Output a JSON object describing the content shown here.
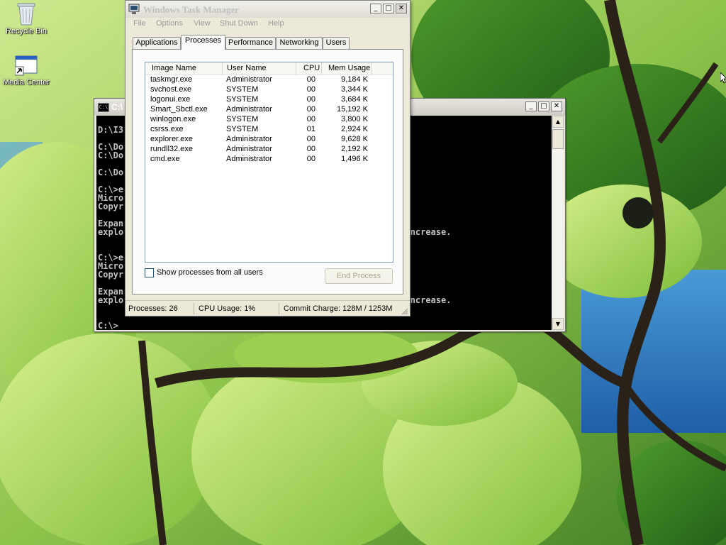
{
  "desktop": {
    "icons": [
      {
        "label": "Recycle Bin",
        "icon": "recycle-bin-icon"
      },
      {
        "label": "Media Center",
        "icon": "media-center-icon"
      }
    ]
  },
  "cmd_window": {
    "title": "C:\\",
    "lines": [
      "D:\\I3",
      "",
      "C:\\Do",
      "C:\\Do",
      "",
      "C:\\Do",
      "",
      "C:\\>e",
      "Micro                                                    @",
      "Copyr                                                    d.",
      "",
      "Expan",
      "explo                                                   89% increase.",
      "",
      "",
      "C:\\>e",
      "Micro                                                    @",
      "Copyr                                                    d.",
      "",
      "Expan",
      "explo                                                   89% increase.",
      "",
      "",
      "C:\\>"
    ],
    "caption_buttons": [
      "_",
      "□",
      "✕"
    ]
  },
  "task_manager": {
    "title": "Windows Task Manager",
    "menu": [
      "File",
      "Options",
      "View",
      "Shut Down",
      "Help"
    ],
    "tabs": [
      "Applications",
      "Processes",
      "Performance",
      "Networking",
      "Users"
    ],
    "active_tab": "Processes",
    "columns": [
      "Image Name",
      "User Name",
      "CPU",
      "Mem Usage"
    ],
    "processes": [
      {
        "name": "taskmgr.exe",
        "user": "Administrator",
        "cpu": "00",
        "mem": "9,184 K"
      },
      {
        "name": "svchost.exe",
        "user": "SYSTEM",
        "cpu": "00",
        "mem": "3,344 K"
      },
      {
        "name": "logonui.exe",
        "user": "SYSTEM",
        "cpu": "00",
        "mem": "3,684 K"
      },
      {
        "name": "Smart_Sbctl.exe",
        "user": "Administrator",
        "cpu": "00",
        "mem": "15,192 K"
      },
      {
        "name": "winlogon.exe",
        "user": "SYSTEM",
        "cpu": "00",
        "mem": "3,800 K"
      },
      {
        "name": "csrss.exe",
        "user": "SYSTEM",
        "cpu": "01",
        "mem": "2,924 K"
      },
      {
        "name": "explorer.exe",
        "user": "Administrator",
        "cpu": "00",
        "mem": "9,628 K"
      },
      {
        "name": "rundll32.exe",
        "user": "Administrator",
        "cpu": "00",
        "mem": "2,192 K"
      },
      {
        "name": "cmd.exe",
        "user": "Administrator",
        "cpu": "00",
        "mem": "1,496 K"
      }
    ],
    "show_all_label": "Show processes from all users",
    "show_all_checked": false,
    "end_process_label": "End Process",
    "status": {
      "processes": "Processes: 26",
      "cpu": "CPU Usage: 1%",
      "commit": "Commit Charge: 128M / 1253M"
    },
    "caption_buttons": [
      "_",
      "□",
      "✕"
    ]
  },
  "colors": {
    "console_bg": "#000000",
    "console_fg": "#c0c0c0",
    "window_face": "#ece9d8",
    "listview_border": "#7f9db9"
  }
}
